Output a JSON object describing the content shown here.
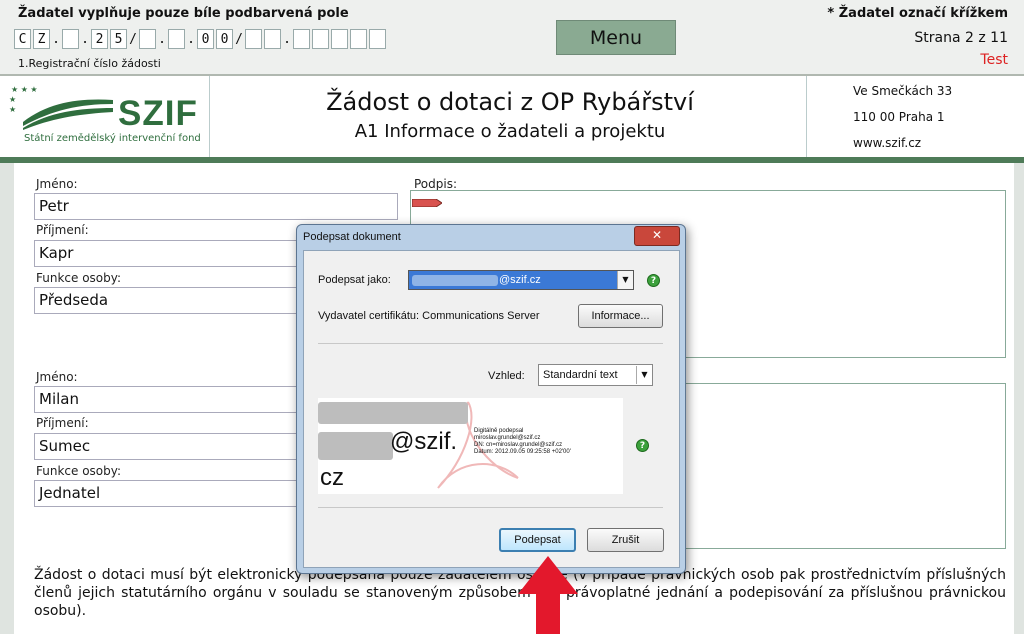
{
  "header": {
    "instruction_left": "Žadatel vyplňuje pouze bíle podbarvená pole",
    "instruction_right": "* Žadatel označí křížkem",
    "menu_label": "Menu",
    "page_label": "Strana 2 z 11",
    "test_label": "Test",
    "reg_number_label": "1.Registrační číslo žádosti",
    "reg_cells": [
      "C",
      "Z",
      ".",
      "",
      ".",
      "2",
      "5",
      "/",
      "",
      ".",
      "",
      ".",
      "0",
      "0",
      "/",
      "",
      "",
      ".",
      "",
      "",
      "",
      "",
      ""
    ],
    "logo_text": "SZIF",
    "logo_subtext": "Státní zemědělský intervenční fond",
    "title": "Žádost o dotaci z OP Rybářství",
    "subtitle": "A1 Informace o žadateli a projektu",
    "address": [
      "Ve Smečkách 33",
      "110 00 Praha 1",
      "www.szif.cz"
    ]
  },
  "persons": [
    {
      "name_label": "Jméno:",
      "name": "Petr",
      "surname_label": "Příjmení:",
      "surname": "Kapr",
      "function_label": "Funkce osoby:",
      "function": "Předseda",
      "signature_label": "Podpis:"
    },
    {
      "name_label": "Jméno:",
      "name": "Milan",
      "surname_label": "Příjmení:",
      "surname": "Sumec",
      "function_label": "Funkce osoby:",
      "function": "Jednatel"
    }
  ],
  "bottom_text": "Žádost o dotaci musí být elektronicky podepsána pouze žadatelem osobně (v případě právnických osob pak prostřednictvím příslušných členů jejich statutárního orgánu v souladu se stanoveným způsobem pro právoplatné jednání a podepisování za příslušnou právnickou osobu).",
  "dialog": {
    "title": "Podepsat dokument",
    "close_symbol": "✕",
    "sign_as_label": "Podepsat jako:",
    "sign_as_value": "@szif.cz",
    "issuer_text": "Vydavatel certifikátu: Communications Server",
    "info_button": "Informace...",
    "appearance_label": "Vzhled:",
    "appearance_value": "Standardní text",
    "preview_big": "@szif.",
    "preview_cz": "cz",
    "preview_small": [
      "Digitálně podepsal",
      "miroslav.grundel@szif.cz",
      "DN: cn=miroslav.grundel@szif.cz",
      "Datum: 2012.09.05 09:25:58 +02'00'"
    ],
    "sign_button": "Podepsat",
    "cancel_button": "Zrušit",
    "help_symbol": "?"
  },
  "colors": {
    "accent_green": "#4e7b58",
    "menu_green": "#8aaa92",
    "arrow_red": "#e3182c"
  }
}
